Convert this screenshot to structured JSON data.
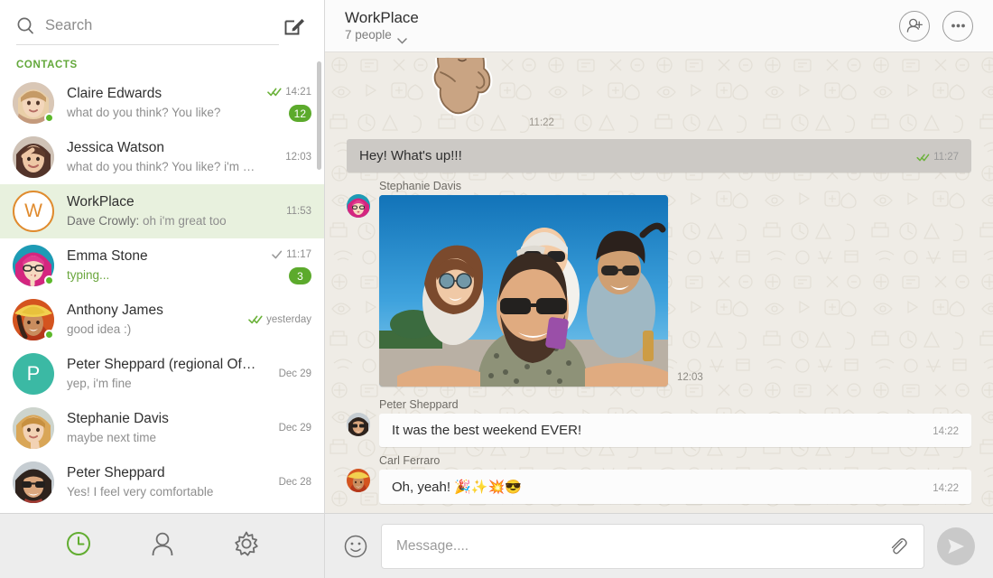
{
  "sidebar": {
    "search": {
      "placeholder": "Search",
      "value": "",
      "icon": "search-icon"
    },
    "compose_icon": "compose-icon",
    "section_label": "CONTACTS",
    "contacts": [
      {
        "name": "Claire Edwards",
        "preview": "what do you think? You like?",
        "time": "14:21",
        "ticks": "double",
        "badge": "12",
        "online": true,
        "avatar_type": "photo",
        "avatar_kind": "woman-blonde",
        "active": false
      },
      {
        "name": "Jessica Watson",
        "preview": "what do you think? You like? i'm wo...",
        "time": "12:03",
        "ticks": "none",
        "badge": "",
        "online": false,
        "avatar_type": "photo",
        "avatar_kind": "woman-brunette",
        "active": false
      },
      {
        "name": "WorkPlace",
        "preview_sender": "Dave Crowly:",
        "preview": "oh i'm great too",
        "time": "11:53",
        "ticks": "none",
        "badge": "",
        "online": false,
        "avatar_type": "initial-outline",
        "avatar_initial": "W",
        "active": true
      },
      {
        "name": "Emma Stone",
        "preview": "typing...",
        "preview_state": "typing",
        "time": "11:17",
        "ticks": "single",
        "badge": "3",
        "online": true,
        "avatar_type": "photo",
        "avatar_kind": "woman-pink-hair",
        "active": false
      },
      {
        "name": "Anthony James",
        "preview": "good idea :)",
        "time": "yesterday",
        "ticks": "double",
        "badge": "",
        "online": true,
        "avatar_type": "photo",
        "avatar_kind": "woman-yellow-hat",
        "active": false
      },
      {
        "name": "Peter Sheppard (regional Of...)",
        "preview": "yep, i'm fine",
        "time": "Dec 29",
        "ticks": "none",
        "badge": "",
        "online": false,
        "avatar_type": "initial-fill",
        "avatar_initial": "P",
        "active": false
      },
      {
        "name": "Stephanie Davis",
        "preview": "maybe next time",
        "time": "Dec 29",
        "ticks": "none",
        "badge": "",
        "online": false,
        "avatar_type": "photo",
        "avatar_kind": "woman-blonde2",
        "active": false
      },
      {
        "name": "Peter Sheppard",
        "preview": "Yes! I feel very comfortable",
        "time": "Dec 28",
        "ticks": "none",
        "badge": "",
        "online": false,
        "avatar_type": "photo",
        "avatar_kind": "man-sunglasses",
        "active": false
      }
    ],
    "footer": [
      {
        "icon": "recent-clock-icon",
        "active": true
      },
      {
        "icon": "contacts-person-icon",
        "active": false
      },
      {
        "icon": "settings-gear-icon",
        "active": false
      }
    ]
  },
  "chat": {
    "title": "WorkPlace",
    "subtitle": "7 people",
    "subtitle_chevron": "chevron-down-icon",
    "actions": [
      {
        "icon": "add-person-icon"
      },
      {
        "icon": "more-options-icon"
      }
    ],
    "messages": [
      {
        "kind": "sticker",
        "sticker_name": "bunny-sticker",
        "time": "11:22",
        "direction": "in"
      },
      {
        "kind": "text",
        "text": "Hey! What's up!!!",
        "time": "11:27",
        "ticks": "double",
        "direction": "out"
      },
      {
        "kind": "photo",
        "sender": "Stephanie Davis",
        "photo_name": "friends-selfie-photo",
        "time": "12:03",
        "direction": "in"
      },
      {
        "kind": "text",
        "sender": "Peter Sheppard",
        "text": "It was the best weekend EVER!",
        "time": "14:22",
        "direction": "in"
      },
      {
        "kind": "text",
        "sender": "Carl Ferraro",
        "text": "Oh, yeah! 🎉✨💥😎",
        "time": "14:22",
        "direction": "in"
      }
    ],
    "composer": {
      "emoji_icon": "emoji-smiley-icon",
      "placeholder": "Message....",
      "value": "",
      "attach_icon": "paperclip-icon",
      "send_icon": "send-icon"
    }
  },
  "colors": {
    "accent_green": "#5caa2c",
    "label_green": "#63a83b",
    "active_row": "#e8f1de",
    "chat_bg": "#efece6",
    "out_bubble": "#ccc9c5",
    "in_bubble": "#fcfcfc",
    "avatar_orange": "#e08b2e",
    "avatar_teal": "#3bb9a4"
  }
}
